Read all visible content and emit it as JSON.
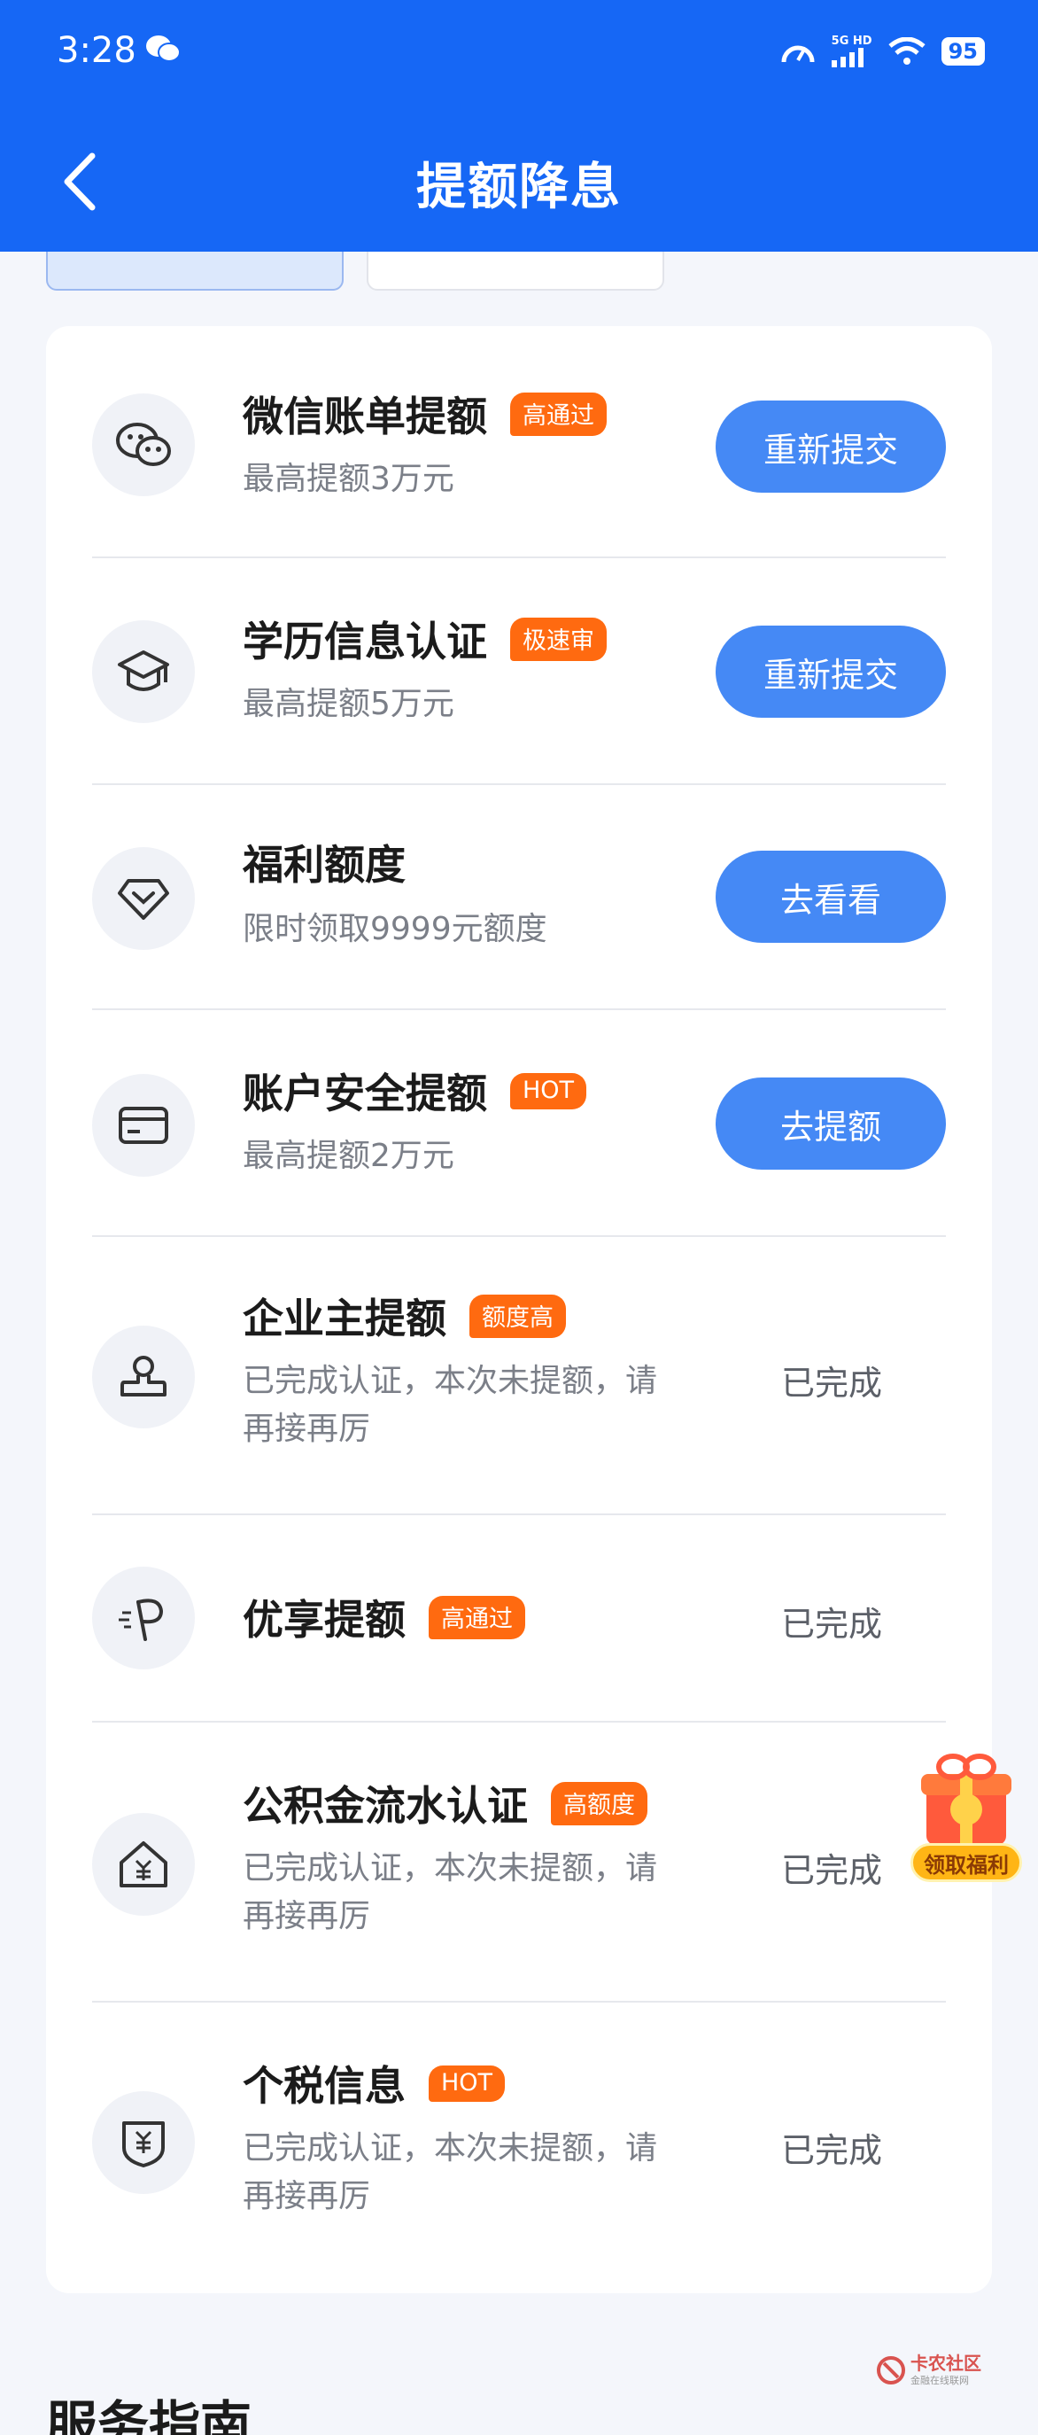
{
  "status_bar": {
    "time": "3:28",
    "network": "5G HD",
    "battery": "95"
  },
  "header": {
    "title": "提额降息"
  },
  "rows": [
    {
      "title": "微信账单提额",
      "tag": "高通过",
      "subtitle": "最高提额3万元",
      "button": "重新提交",
      "icon": "wechat-icon"
    },
    {
      "title": "学历信息认证",
      "tag": "极速审",
      "subtitle": "最高提额5万元",
      "button": "重新提交",
      "icon": "graduation-cap-icon"
    },
    {
      "title": "福利额度",
      "subtitle": "限时领取9999元额度",
      "button": "去看看",
      "icon": "diamond-icon"
    },
    {
      "title": "账户安全提额",
      "tag": "HOT",
      "subtitle": "最高提额2万元",
      "button": "去提额",
      "icon": "card-icon"
    },
    {
      "title": "企业主提额",
      "tag": "额度高",
      "subtitle_line1": "已完成认证，本次未提额，请",
      "subtitle_line2": "再接再厉",
      "status": "已完成",
      "icon": "stamp-icon"
    },
    {
      "title": "优享提额",
      "tag": "高通过",
      "status": "已完成",
      "icon": "speed-p-icon"
    },
    {
      "title": "公积金流水认证",
      "tag": "高额度",
      "subtitle_line1": "已完成认证，本次未提额，请",
      "subtitle_line2": "再接再厉",
      "status": "已完成",
      "icon": "house-yuan-icon"
    },
    {
      "title": "个税信息",
      "tag": "HOT",
      "subtitle_line1": "已完成认证，本次未提额，请",
      "subtitle_line2": "再接再厉",
      "status": "已完成",
      "icon": "shield-yuan-icon"
    }
  ],
  "floating": {
    "label": "领取福利"
  },
  "section": {
    "title": "服务指南"
  },
  "watermark": {
    "name": "卡农社区",
    "slogan": "金融在线联网"
  },
  "colors": {
    "header": "#1667f5",
    "button": "#4589f5",
    "tag": "#ff6a10"
  }
}
